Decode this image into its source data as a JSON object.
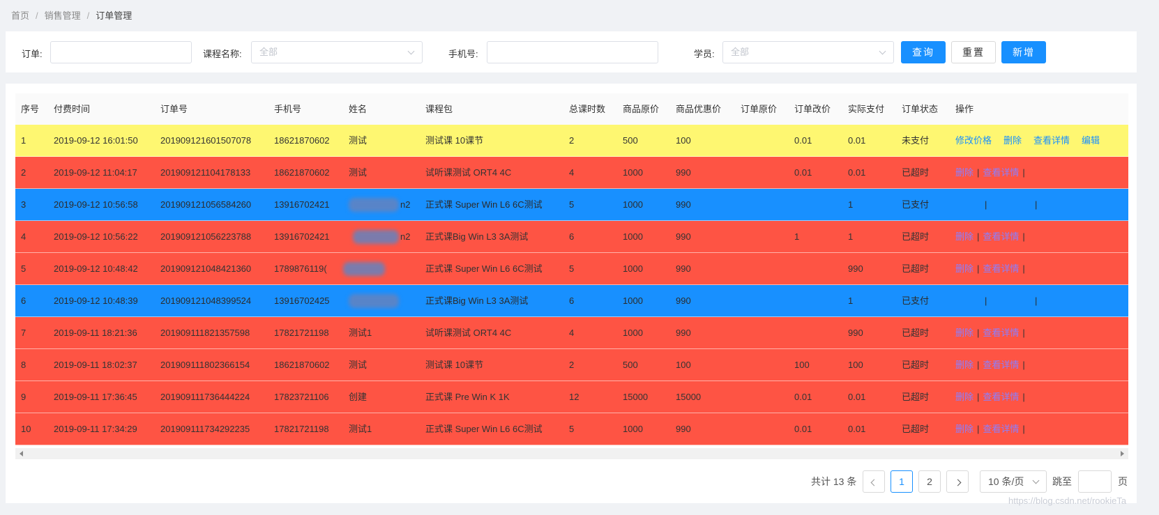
{
  "breadcrumb": [
    "首页",
    "销售管理",
    "订单管理"
  ],
  "search": {
    "order_label": "订单:",
    "course_label": "课程名称:",
    "course_placeholder": "全部",
    "phone_label": "手机号:",
    "student_label": "学员:",
    "student_placeholder": "全部",
    "query_btn": "查询",
    "reset_btn": "重置",
    "add_btn": "新增"
  },
  "table": {
    "columns": [
      "序号",
      "付费时间",
      "订单号",
      "手机号",
      "姓名",
      "课程包",
      "总课时数",
      "商品原价",
      "商品优惠价",
      "订单原价",
      "订单改价",
      "实际支付",
      "订单状态",
      "操作"
    ],
    "rows": [
      {
        "no": "1",
        "time": "2019-09-12 16:01:50",
        "order": "201909121601507078",
        "phone": "18621870602",
        "name": "测试",
        "course": "测试课 10课节",
        "hours": "2",
        "orig": "500",
        "disc": "100",
        "order_orig": "",
        "change": "0.01",
        "paid": "0.01",
        "status": "未支付",
        "color": "#fef771"
      },
      {
        "no": "2",
        "time": "2019-09-12 11:04:17",
        "order": "201909121104178133",
        "phone": "18621870602",
        "name": "测试",
        "course": "试听课测试 ORT4 4C",
        "hours": "4",
        "orig": "1000",
        "disc": "990",
        "order_orig": "",
        "change": "0.01",
        "paid": "0.01",
        "status": "已超时",
        "color": "#fe5444"
      },
      {
        "no": "3",
        "time": "2019-09-12 10:56:58",
        "order": "201909121056584260",
        "phone": "13916702421",
        "name": "n2",
        "course": "正式课 Super Win L6 6C测试",
        "hours": "5",
        "orig": "1000",
        "disc": "990",
        "order_orig": "",
        "change": "",
        "paid": "1",
        "status": "已支付",
        "color": "#1890ff"
      },
      {
        "no": "4",
        "time": "2019-09-12 10:56:22",
        "order": "201909121056223788",
        "phone": "13916702421",
        "name": "n2",
        "course": "正式课Big Win L3 3A测试",
        "hours": "6",
        "orig": "1000",
        "disc": "990",
        "order_orig": "",
        "change": "1",
        "paid": "1",
        "status": "已超时",
        "color": "#fe5444"
      },
      {
        "no": "5",
        "time": "2019-09-12 10:48:42",
        "order": "201909121048421360",
        "phone": "1789876119(",
        "name": "",
        "course": "正式课 Super Win L6 6C测试",
        "hours": "5",
        "orig": "1000",
        "disc": "990",
        "order_orig": "",
        "change": "",
        "paid": "990",
        "status": "已超时",
        "color": "#fe5444"
      },
      {
        "no": "6",
        "time": "2019-09-12 10:48:39",
        "order": "201909121048399524",
        "phone": "13916702425",
        "name": "",
        "course": "正式课Big Win L3 3A测试",
        "hours": "6",
        "orig": "1000",
        "disc": "990",
        "order_orig": "",
        "change": "",
        "paid": "1",
        "status": "已支付",
        "color": "#1890ff"
      },
      {
        "no": "7",
        "time": "2019-09-11 18:21:36",
        "order": "201909111821357598",
        "phone": "17821721198",
        "name": "测试1",
        "course": "试听课测试 ORT4 4C",
        "hours": "4",
        "orig": "1000",
        "disc": "990",
        "order_orig": "",
        "change": "",
        "paid": "990",
        "status": "已超时",
        "color": "#fe5444"
      },
      {
        "no": "8",
        "time": "2019-09-11 18:02:37",
        "order": "201909111802366154",
        "phone": "18621870602",
        "name": "测试",
        "course": "测试课 10课节",
        "hours": "2",
        "orig": "500",
        "disc": "100",
        "order_orig": "",
        "change": "100",
        "paid": "100",
        "status": "已超时",
        "color": "#fe5444"
      },
      {
        "no": "9",
        "time": "2019-09-11 17:36:45",
        "order": "201909111736444224",
        "phone": "17823721106",
        "name": "创建",
        "course": "正式课 Pre Win K 1K",
        "hours": "12",
        "orig": "15000",
        "disc": "15000",
        "order_orig": "",
        "change": "0.01",
        "paid": "0.01",
        "status": "已超时",
        "color": "#fe5444"
      },
      {
        "no": "10",
        "time": "2019-09-11 17:34:29",
        "order": "201909111734292235",
        "phone": "17821721198",
        "name": "测试1",
        "course": "正式课 Super Win L6 6C测试",
        "hours": "5",
        "orig": "1000",
        "disc": "990",
        "order_orig": "",
        "change": "0.01",
        "paid": "0.01",
        "status": "已超时",
        "color": "#fe5444"
      }
    ],
    "ops": {
      "modify_price": "修改价格",
      "delete": "删除",
      "view_detail": "查看详情",
      "edit": "编辑",
      "separator": "|"
    }
  },
  "pagination": {
    "total": "共计 13 条",
    "pages": [
      "1",
      "2"
    ],
    "page_size": "10 条/页",
    "goto": "跳至",
    "page_unit": "页"
  },
  "watermark": "https://blog.csdn.net/rookieTa"
}
